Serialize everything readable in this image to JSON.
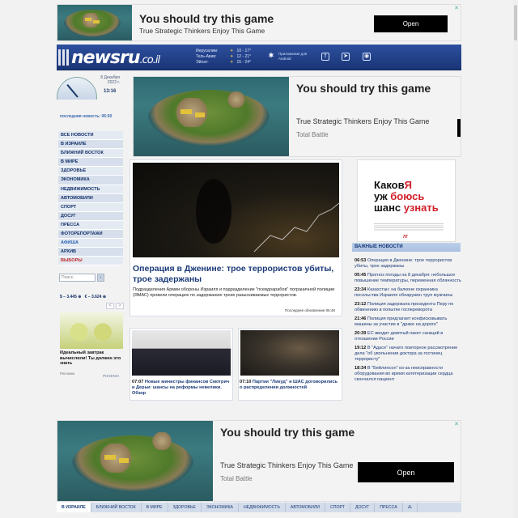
{
  "ads": {
    "top": {
      "title": "You should try this game",
      "subtitle": "True Strategic Thinkers Enjoy This Game",
      "button": "Open"
    },
    "middle": {
      "title": "You should try this game",
      "subtitle": "True Strategic Thinkers Enjoy This Game",
      "brand": "Total Battle"
    },
    "bottom": {
      "title": "You should try this game",
      "subtitle": "True Strategic Thinkers Enjoy This Game",
      "brand": "Total Battle",
      "button": "Open"
    },
    "side": {
      "line1a": "Каков",
      "line1b": "Я",
      "line2a": "уж ",
      "line2b": "боюсь",
      "line3a": "шанс ",
      "line3b": "узнать",
      "logo": "ЛГ"
    }
  },
  "header": {
    "logo_main": "newsru",
    "logo_tld": ".co.il",
    "weather": [
      {
        "city": "Иерусалим:",
        "temp": "10 - 17°"
      },
      {
        "city": "Тель-Авив:",
        "temp": "12 - 21°"
      },
      {
        "city": "Эйлат:",
        "temp": "15 - 24°"
      }
    ],
    "app_label": "Приложение для Android",
    "social_icons": [
      "facebook-icon",
      "telegram-icon",
      "rss-icon"
    ]
  },
  "clock": {
    "date": "8 Декабря 2022 г.",
    "time": "13:16"
  },
  "last_news": "последняя новость: 06:50",
  "menu": [
    "ВСЕ НОВОСТИ",
    "В ИЗРАИЛЕ",
    "БЛИЖНИЙ ВОСТОК",
    "В МИРЕ",
    "ЗДОРОВЬЕ",
    "ЭКОНОМИКА",
    "НЕДВИЖИМОСТЬ",
    "АВТОМОБИЛИ",
    "СПОРТ",
    "ДОСУГ",
    "ПРЕССА",
    "ФОТОРЕПОРТАЖИ",
    "АФИША",
    "АРХИВ",
    "ВЫБОРЫ"
  ],
  "search": {
    "placeholder": "Поиск..",
    "button": "›"
  },
  "rates": {
    "usd": "$ – 3.445 ⊕",
    "eur": "€ – 3.624 ⊕",
    "prev": "<",
    "next": ">"
  },
  "promo": {
    "text": "Идеальный завтрак вычислили! Ты должен это знать",
    "source": "Реклама",
    "brand": "PHOENIX"
  },
  "main_story": {
    "title": "Операция в Дженине: трое террористов убиты, трое задержаны",
    "lead": "Подразделения Армии обороны Израиля и подразделение \"псевдоарабов\" пограничной полиции (ЯМАС) провели операцию по задержанию троих разыскиваемых террористов.",
    "updated": "Последнее обновление 06:49"
  },
  "sub_stories": [
    {
      "time": "07:07",
      "title": "Новые министры финансов Смотрич и Дерьи: шансы на реформы невелики. Обзор"
    },
    {
      "time": "07:10",
      "title": "Партии \"Ликуд\" и ШАС договорились о распределении должностей"
    }
  ],
  "important_news": {
    "header": "ВАЖНЫЕ НОВОСТИ",
    "items": [
      {
        "time": "06:53",
        "text": "Операция в Дженине: трое террористов убиты, трое задержаны"
      },
      {
        "time": "05:45",
        "text": "Прогноз погоды на 8 декабря: небольшое повышение температуры, переменная облачность"
      },
      {
        "time": "23:34",
        "text": "Казахстан: на балконе охранника посольства Израиля обнаружен труп мужчины"
      },
      {
        "time": "23:12",
        "text": "Полиция задержала президента Перу по обвинению в попытке госпереворота"
      },
      {
        "time": "21:46",
        "text": "Полиция предлагает конфисковывать машины за участие в \"драке на дороге\""
      },
      {
        "time": "20:39",
        "text": "ЕС вводит девятый пакет санкций в отношении России"
      },
      {
        "time": "19:12",
        "text": "В \"Адасе\" начато повторное рассмотрение дела \"об увольнении доктора за гостинец террористу\""
      },
      {
        "time": "18:34",
        "text": "В \"Бейлинсон\" из-за неисправности оборудования во время катетеризации сердца скончался пациент"
      }
    ]
  },
  "bottom_nav": [
    "В ИЗРАИЛЕ",
    "БЛИЖНИЙ ВОСТОК",
    "В МИРЕ",
    "ЗДОРОВЬЕ",
    "ЭКОНОМИКА",
    "НЕДВИЖИМОСТЬ",
    "АВТОМОБИЛИ",
    "СПОРТ",
    "ДОСУГ",
    "ПРЕССА",
    "⁂"
  ]
}
